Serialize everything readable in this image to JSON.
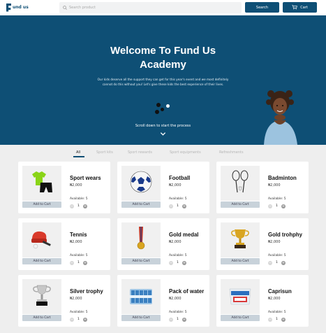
{
  "header": {
    "logo_text": "und us",
    "search_placeholder": "Search product",
    "search_button": "Search",
    "cart_button": "Cart"
  },
  "hero": {
    "title_line1": "Welcome To Fund Us",
    "title_line2": "Academy",
    "subtitle_line1": "Our kids deserve all the support they can get for this year's event and we most definitely",
    "subtitle_line2": "cannot do this without you! Let's give these kids the best experience of their lives.",
    "scroll_text": "Scroll down to start the process"
  },
  "tabs": [
    "All",
    "Sport kits",
    "Sport rewards",
    "Sport equipments",
    "Refreshments"
  ],
  "active_tab": "All",
  "product_labels": {
    "add_to_cart": "Add to Cart",
    "available": "Available: 5",
    "quantity": "1"
  },
  "products": [
    {
      "name": "Sport wears",
      "price": "₦2,000",
      "icon": "sport-wear-icon"
    },
    {
      "name": "Football",
      "price": "₦2,000",
      "icon": "football-icon"
    },
    {
      "name": "Badminton",
      "price": "₦2,000",
      "icon": "badminton-icon"
    },
    {
      "name": "Tennis",
      "price": "₦2,000",
      "icon": "table-tennis-icon"
    },
    {
      "name": "Gold medal",
      "price": "₦2,000",
      "icon": "gold-medal-icon"
    },
    {
      "name": "Gold trohphy",
      "price": "₦2,000",
      "icon": "gold-trophy-icon"
    },
    {
      "name": "Silver trophy",
      "price": "₦2,000",
      "icon": "silver-trophy-icon"
    },
    {
      "name": "Pack of water",
      "price": "₦2,000",
      "icon": "water-pack-icon"
    },
    {
      "name": "Caprisun",
      "price": "₦2,000",
      "icon": "caprisun-icon"
    }
  ],
  "colors": {
    "primary": "#0e4f75",
    "card_bg": "#ffffff",
    "page_bg": "#eeeeee",
    "add_button_bg": "#c8d2da"
  }
}
